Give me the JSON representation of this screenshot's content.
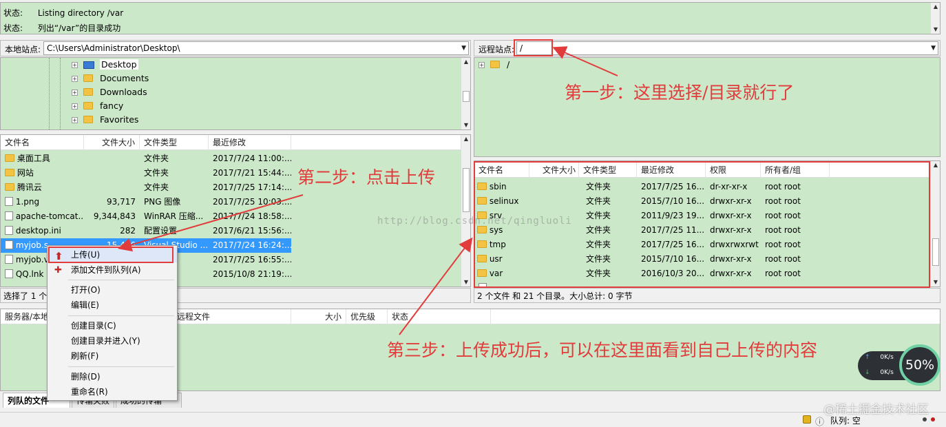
{
  "status_log": [
    {
      "label": "状态:",
      "text": "Listing directory /var"
    },
    {
      "label": "状态:",
      "text": "列出“/var”的目录成功"
    }
  ],
  "local": {
    "site_label": "本地站点:",
    "site_path": "C:\\Users\\Administrator\\Desktop\\",
    "tree": [
      "Desktop",
      "Documents",
      "Downloads",
      "fancy",
      "Favorites"
    ],
    "headers": [
      "文件名",
      "文件大小",
      "文件类型",
      "最近修改"
    ],
    "files": [
      {
        "name": "桌面工具",
        "size": "",
        "type": "文件夹",
        "modified": "2017/7/24 11:00:..."
      },
      {
        "name": "网站",
        "size": "",
        "type": "文件夹",
        "modified": "2017/7/21 15:44:..."
      },
      {
        "name": "腾讯云",
        "size": "",
        "type": "文件夹",
        "modified": "2017/7/25 17:14:..."
      },
      {
        "name": "1.png",
        "size": "93,717",
        "type": "PNG 图像",
        "modified": "2017/7/25 10:03:..."
      },
      {
        "name": "apache-tomcat...",
        "size": "9,344,843",
        "type": "WinRAR 压缩...",
        "modified": "2017/7/24 18:58:..."
      },
      {
        "name": "desktop.ini",
        "size": "282",
        "type": "配置设置",
        "modified": "2017/6/21 15:56:..."
      },
      {
        "name": "myjob.s...",
        "size": "15,406",
        "type": "Visual Studio ...",
        "modified": "2017/7/24 16:24:..."
      },
      {
        "name": "myjob.v...",
        "size": "",
        "type": "...件",
        "modified": "2017/7/25 16:55:..."
      },
      {
        "name": "QQ.lnk",
        "size": "",
        "type": "",
        "modified": "2015/10/8 21:19:..."
      }
    ],
    "status_text": "选择了 1 个"
  },
  "remote": {
    "site_label": "远程站点:",
    "site_path": "/",
    "tree_root": "/",
    "headers": [
      "文件名",
      "文件大小",
      "文件类型",
      "最近修改",
      "权限",
      "所有者/组"
    ],
    "files": [
      {
        "name": "sbin",
        "size": "",
        "type": "文件夹",
        "modified": "2017/7/25 16...",
        "perm": "dr-xr-xr-x",
        "owner": "root root"
      },
      {
        "name": "selinux",
        "size": "",
        "type": "文件夹",
        "modified": "2015/7/10 16...",
        "perm": "drwxr-xr-x",
        "owner": "root root"
      },
      {
        "name": "srv",
        "size": "",
        "type": "文件夹",
        "modified": "2011/9/23 19...",
        "perm": "drwxr-xr-x",
        "owner": "root root"
      },
      {
        "name": "sys",
        "size": "",
        "type": "文件夹",
        "modified": "2017/7/25 11...",
        "perm": "drwxr-xr-x",
        "owner": "root root"
      },
      {
        "name": "tmp",
        "size": "",
        "type": "文件夹",
        "modified": "2017/7/25 16...",
        "perm": "drwxrwxrwt",
        "owner": "root root"
      },
      {
        "name": "usr",
        "size": "",
        "type": "文件夹",
        "modified": "2015/7/10 16...",
        "perm": "drwxr-xr-x",
        "owner": "root root"
      },
      {
        "name": "var",
        "size": "",
        "type": "文件夹",
        "modified": "2016/10/3 20...",
        "perm": "drwxr-xr-x",
        "owner": "root root"
      }
    ],
    "status_text": "2 个文件 和 21 个目录。大小总计: 0 字节"
  },
  "queue": {
    "headers": [
      "服务器/本地",
      "远程文件",
      "大小",
      "优先级",
      "状态"
    ],
    "tabs": [
      "列队的文件",
      "传输失败",
      "成功的传输"
    ],
    "status": "队列: 空"
  },
  "context_menu": {
    "items": [
      "上传(U)",
      "添加文件到队列(A)",
      "打开(O)",
      "编辑(E)",
      "创建目录(C)",
      "创建目录并进入(Y)",
      "刷新(F)",
      "删除(D)",
      "重命名(R)"
    ]
  },
  "annotations": {
    "step1": "第一步：这里选择/目录就行了",
    "step2": "第二步：点击上传",
    "step3": "第三步：上传成功后，可以在这里面看到自己上传的内容"
  },
  "watermark": "http://blog.csdn.net/qingluoli",
  "site_watermark": "@稀土掘金技术社区",
  "speed_widget": {
    "up": "0K/s",
    "down": "0K/s",
    "percent": "50%"
  },
  "colors": {
    "panel_green": "#cbe8c9",
    "annotation_red": "#e23b3b",
    "selection_blue": "#3399ff"
  }
}
